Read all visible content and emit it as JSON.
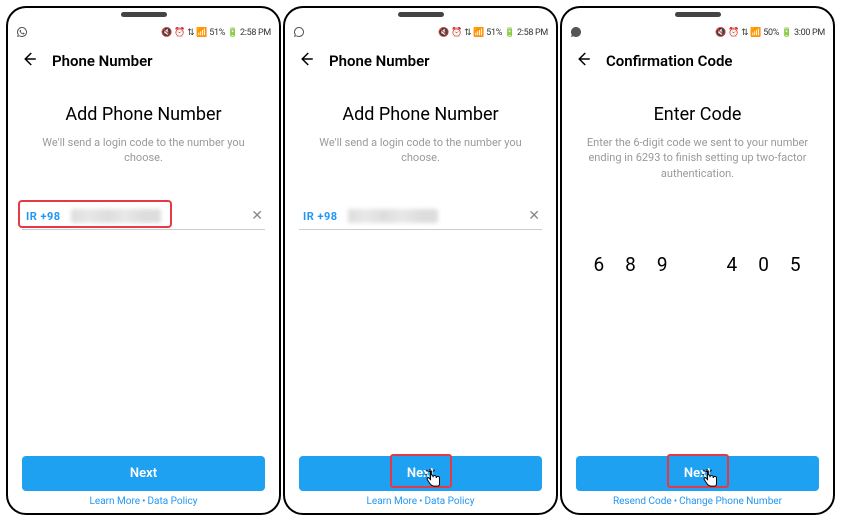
{
  "screens": [
    {
      "statusbar": {
        "battery": "51%",
        "time": "2:58 PM"
      },
      "header": "Phone Number",
      "heading": "Add Phone Number",
      "subtext": "We'll send a login code to the number you choose.",
      "country": "IR +98",
      "clear": "✕",
      "button": "Next",
      "footer": {
        "a": "Learn More",
        "b": "Data Policy"
      }
    },
    {
      "statusbar": {
        "battery": "51%",
        "time": "2:58 PM"
      },
      "header": "Phone Number",
      "heading": "Add Phone Number",
      "subtext": "We'll send a login code to the number you choose.",
      "country": "IR +98",
      "clear": "✕",
      "button": "Next",
      "footer": {
        "a": "Learn More",
        "b": "Data Policy"
      }
    },
    {
      "statusbar": {
        "battery": "50%",
        "time": "3:00 PM"
      },
      "header": "Confirmation Code",
      "heading": "Enter Code",
      "subtext": "Enter the 6-digit code we sent to your number ending in 6293 to finish setting up two-factor authentication.",
      "code": [
        "6",
        "8",
        "9",
        "4",
        "0",
        "5"
      ],
      "button": "Next",
      "footer": {
        "a": "Resend Code",
        "b": "Change Phone Number"
      }
    }
  ]
}
